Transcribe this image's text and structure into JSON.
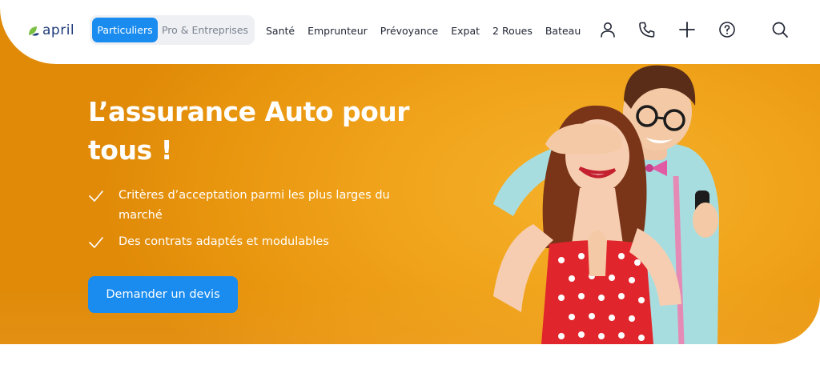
{
  "header": {
    "logo_text": "april",
    "segments": [
      {
        "label": "Particuliers",
        "active": true
      },
      {
        "label": "Pro & Entreprises",
        "active": false
      }
    ],
    "nav": [
      "Santé",
      "Emprunteur",
      "Prévoyance",
      "Expat",
      "2 Roues",
      "Bateau"
    ],
    "icons": [
      "user-icon",
      "phone-icon",
      "plus-icon",
      "help-icon",
      "search-icon"
    ]
  },
  "hero": {
    "title": "L’assurance Auto pour tous !",
    "features": [
      "Critères d’acceptation parmi les plus larges du marché",
      "Des contrats adaptés et modulables"
    ],
    "cta_label": "Demander un devis"
  },
  "colors": {
    "brand_blue": "#1a8cf0",
    "hero_orange": "#f0a41c",
    "logo_navy": "#1f3b7a",
    "logo_green": "#7ac143"
  }
}
